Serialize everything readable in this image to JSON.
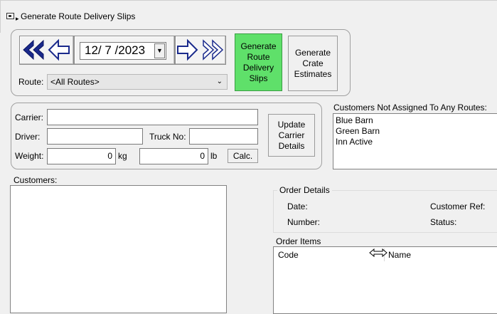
{
  "window": {
    "title": "Generate Route Delivery Slips"
  },
  "date": {
    "value": "12/ 7 /2023"
  },
  "route": {
    "label": "Route:",
    "selected": "<All Routes>"
  },
  "buttons": {
    "generate_slips": "Generate\nRoute\nDelivery\nSlips",
    "generate_crate": "Generate\nCrate\nEstimates",
    "update_carrier": "Update\nCarrier\nDetails",
    "calc": "Calc."
  },
  "carrier": {
    "carrier_label": "Carrier:",
    "carrier_value": "",
    "driver_label": "Driver:",
    "driver_value": "",
    "truck_label": "Truck No:",
    "truck_value": "",
    "weight_label": "Weight:",
    "weight_kg": "0",
    "kg_unit": "kg",
    "weight_lb": "0",
    "lb_unit": "lb"
  },
  "unassigned": {
    "label": "Customers Not Assigned To Any Routes:",
    "items": [
      "Blue Barn",
      "Green Barn",
      "Inn Active"
    ]
  },
  "customers": {
    "label": "Customers:"
  },
  "order_details": {
    "label": "Order Details",
    "date_label": "Date:",
    "number_label": "Number:",
    "customer_ref_label": "Customer Ref:",
    "status_label": "Status:"
  },
  "order_items": {
    "label": "Order Items",
    "columns": [
      "Code",
      "Name"
    ]
  },
  "colors": {
    "accent_green": "#5fe06a",
    "nav_arrow_blue": "#1a2a8c"
  }
}
